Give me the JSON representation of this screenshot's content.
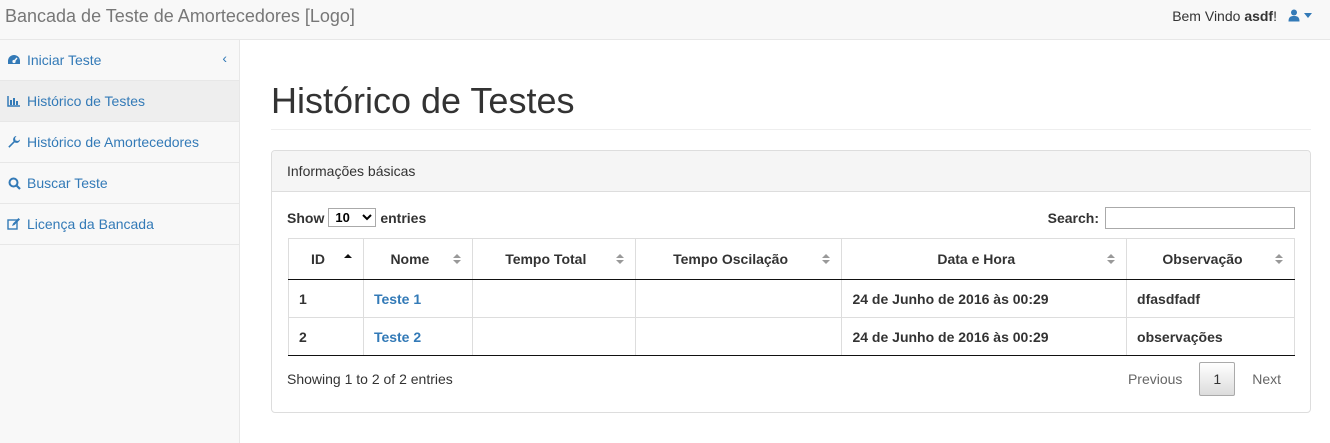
{
  "navbar": {
    "brand": "Bancada de Teste de Amortecedores [Logo]",
    "welcome_prefix": "Bem Vindo ",
    "username": "asdf",
    "welcome_suffix": "!",
    "user_icon": "user-icon"
  },
  "sidebar": {
    "items": [
      {
        "label": "Iniciar Teste",
        "icon": "dashboard-icon",
        "active": false
      },
      {
        "label": "Histórico de Testes",
        "icon": "bar-chart-icon",
        "active": true
      },
      {
        "label": "Histórico de Amortecedores",
        "icon": "wrench-icon",
        "active": false
      },
      {
        "label": "Buscar Teste",
        "icon": "search-icon",
        "active": false
      },
      {
        "label": "Licença da Bancada",
        "icon": "edit-icon",
        "active": false
      }
    ],
    "collapse_glyph": "‹"
  },
  "main": {
    "title": "Histórico de Testes",
    "panel_heading": "Informações básicas",
    "length": {
      "show_label": "Show",
      "selected": "10",
      "entries_label": "entries"
    },
    "search": {
      "label": "Search:",
      "value": "",
      "placeholder": ""
    },
    "table": {
      "columns": [
        "ID",
        "Nome",
        "Tempo Total",
        "Tempo Oscilação",
        "Data e Hora",
        "Observação"
      ],
      "rows": [
        {
          "id": "1",
          "nome": "Teste 1",
          "tempo_total": "",
          "tempo_oscilacao": "",
          "data_hora": "24 de Junho de 2016 às 00:29",
          "observacao": "dfasdfadf"
        },
        {
          "id": "2",
          "nome": "Teste 2",
          "tempo_total": "",
          "tempo_oscilacao": "",
          "data_hora": "24 de Junho de 2016 às 00:29",
          "observacao": "observações"
        }
      ]
    },
    "info": "Showing 1 to 2 of 2 entries",
    "pagination": {
      "previous": "Previous",
      "current": "1",
      "next": "Next"
    }
  },
  "colors": {
    "link": "#337ab7",
    "navbar_bg": "#f8f8f8",
    "panel_heading_bg": "#f5f5f5"
  }
}
